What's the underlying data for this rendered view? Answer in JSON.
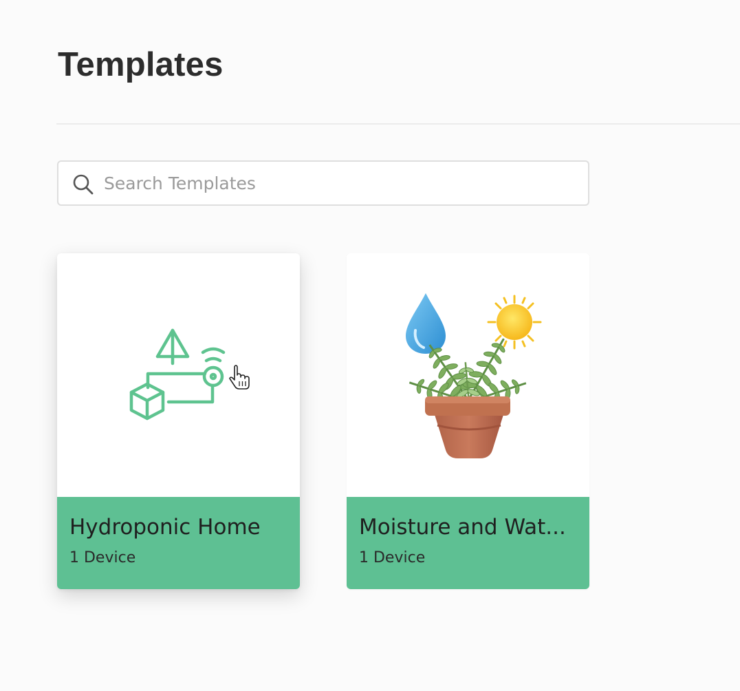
{
  "header": {
    "title": "Templates"
  },
  "search": {
    "placeholder": "Search Templates",
    "icon": "search-icon"
  },
  "templates": [
    {
      "title": "Hydroponic Home",
      "subtitle": "1 Device",
      "icon": "hydroponic-devices-icon",
      "accent": "#5ec093"
    },
    {
      "title": "Moisture and Wat...",
      "subtitle": "1 Device",
      "icon": "plant-water-sun-icon",
      "accent": "#5ec093"
    }
  ],
  "colors": {
    "accent": "#5ec093",
    "icon_stroke": "#5ec38f"
  }
}
